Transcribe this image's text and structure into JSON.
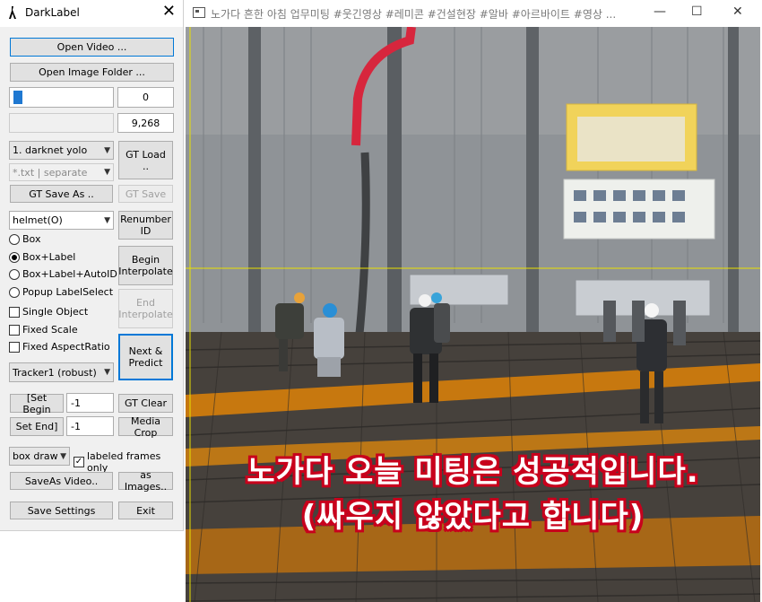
{
  "app": {
    "title": "DarkLabel",
    "close_glyph": "✕"
  },
  "panel": {
    "open_video": "Open Video ...",
    "open_image_folder": "Open Image Folder ...",
    "frame_index": "0",
    "frame_count": "9,268",
    "frame_progress": 0.03,
    "format_select": "1. darknet yolo",
    "gt_load": "GT Load ..",
    "extension_select": "*.txt | separate",
    "gt_save_as": "GT Save As ..",
    "gt_save": "GT Save",
    "label_select": "helmet(O)",
    "renumber_id": "Renumber ID",
    "modes": [
      {
        "label": "Box",
        "selected": false
      },
      {
        "label": "Box+Label",
        "selected": true
      },
      {
        "label": "Box+Label+AutoID",
        "selected": false
      },
      {
        "label": "Popup LabelSelect",
        "selected": false
      }
    ],
    "begin_interpolate": "Begin Interpolate",
    "end_interpolate": "End Interpolate",
    "checks": [
      {
        "label": "Single Object",
        "checked": false
      },
      {
        "label": "Fixed Scale",
        "checked": false
      },
      {
        "label": "Fixed AspectRatio",
        "checked": false
      }
    ],
    "next_predict": "Next & Predict",
    "tracker_select": "Tracker1 (robust)",
    "set_begin": "[Set Begin",
    "set_begin_value": "-1",
    "gt_clear": "GT Clear",
    "set_end": "Set End]",
    "set_end_value": "-1",
    "media_crop": "Media Crop",
    "draw_select": "box draw",
    "labeled_frames_only": "labeled frames only",
    "labeled_frames_checked": true,
    "save_as_video": "SaveAs Video..",
    "as_images": "as Images..",
    "save_settings": "Save Settings",
    "exit": "Exit"
  },
  "video": {
    "title": "노가다 흔한 아침 업무미팅 #웃긴영상 #레미콘 #건설현장 #알바 #아르바이트 #영상 ...",
    "minimize_glyph": "—",
    "maximize_glyph": "☐",
    "close_glyph": "✕",
    "caption_line1": "노가다 오늘 미팅은 성공적입니다.",
    "caption_line2": "(싸우지 않았다고 합니다)",
    "crosshair_color": "#e8e000",
    "caption_color": "#c8001c"
  }
}
